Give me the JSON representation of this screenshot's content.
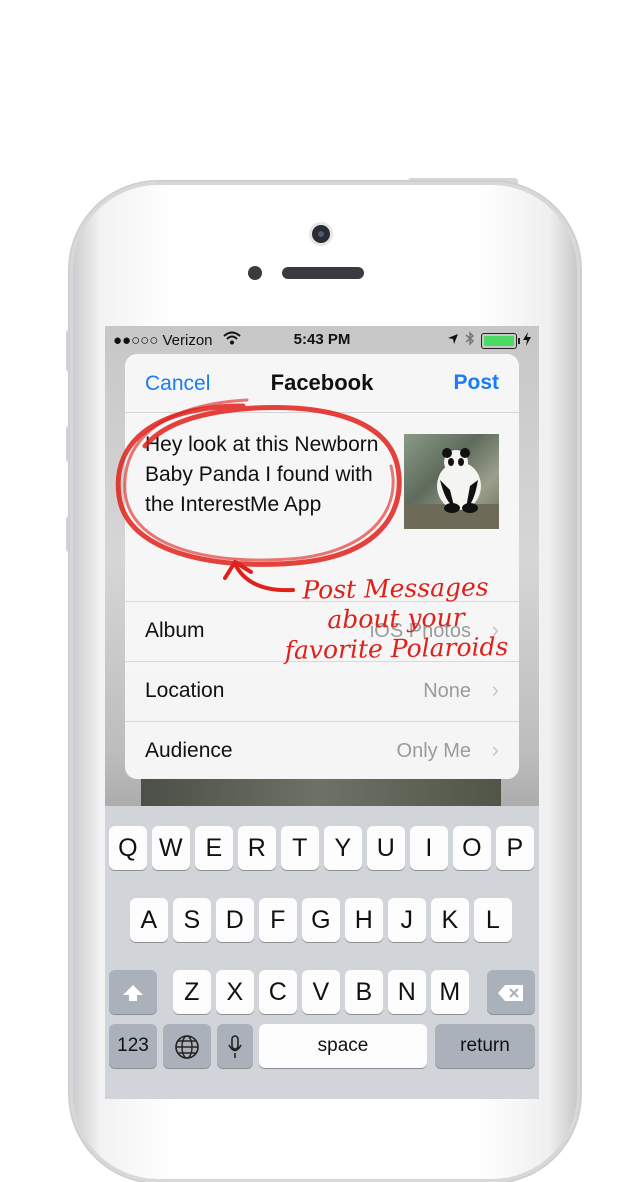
{
  "status_bar": {
    "carrier": "●●○○○ Verizon",
    "time": "5:43 PM",
    "wifi_icon": "wifi-icon",
    "location_icon": "location-arrow-icon",
    "bluetooth_icon": "bluetooth-icon",
    "battery_icon": "battery-full-icon"
  },
  "compose": {
    "cancel_label": "Cancel",
    "title": "Facebook",
    "post_label": "Post",
    "message": "Hey look at this Newborn Baby Panda I found with the InterestMe App",
    "rows": [
      {
        "label": "Album",
        "value": "iOS Photos"
      },
      {
        "label": "Location",
        "value": "None"
      },
      {
        "label": "Audience",
        "value": "Only Me"
      }
    ]
  },
  "annotation": {
    "line1": "Post Messages",
    "line2": "about your",
    "line3": "favorite Polaroids",
    "color": "#e0201b"
  },
  "keyboard": {
    "row1": [
      "Q",
      "W",
      "E",
      "R",
      "T",
      "Y",
      "U",
      "I",
      "O",
      "P"
    ],
    "row2": [
      "A",
      "S",
      "D",
      "F",
      "G",
      "H",
      "J",
      "K",
      "L"
    ],
    "row3": [
      "Z",
      "X",
      "C",
      "V",
      "B",
      "N",
      "M"
    ],
    "numbers_label": "123",
    "space_label": "space",
    "return_label": "return",
    "shift_icon": "shift-arrow-icon",
    "delete_icon": "backspace-icon",
    "globe_icon": "globe-icon",
    "mic_icon": "microphone-icon"
  }
}
